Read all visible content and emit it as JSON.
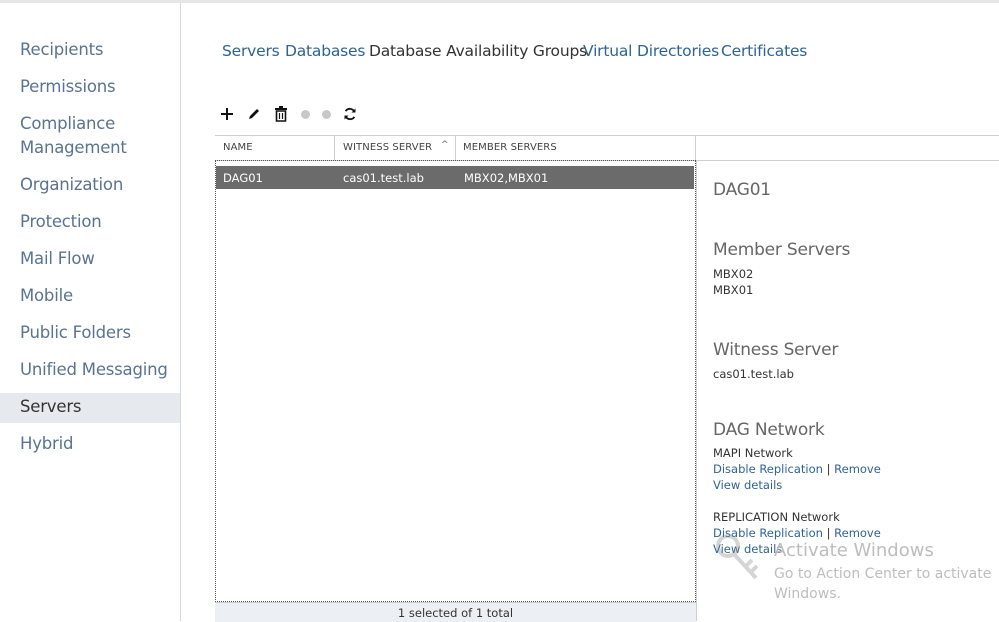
{
  "sidebar": {
    "items": [
      {
        "label": "Recipients"
      },
      {
        "label": "Permissions"
      },
      {
        "label_line1": "Compliance",
        "label_line2": "Management"
      },
      {
        "label": "Organization"
      },
      {
        "label": "Protection"
      },
      {
        "label": "Mail Flow"
      },
      {
        "label": "Mobile"
      },
      {
        "label": "Public Folders"
      },
      {
        "label": "Unified Messaging"
      },
      {
        "label": "Servers",
        "selected": true
      },
      {
        "label": "Hybrid"
      }
    ]
  },
  "tabs": [
    {
      "label": "Servers"
    },
    {
      "label": "Databases"
    },
    {
      "label": "Database Availability Groups",
      "active": true
    },
    {
      "label": "Virtual Directories"
    },
    {
      "label": "Certificates"
    }
  ],
  "toolbar": {
    "icons": [
      "add-icon",
      "edit-icon",
      "delete-icon",
      "disabled-action-icon",
      "disabled-action-icon",
      "refresh-icon"
    ]
  },
  "grid": {
    "columns": [
      "NAME",
      "WITNESS SERVER",
      "MEMBER SERVERS"
    ],
    "rows": [
      {
        "name": "DAG01",
        "witness": "cas01.test.lab",
        "members": "MBX02,MBX01",
        "selected": true
      }
    ],
    "status": "1 selected of 1 total"
  },
  "details": {
    "name": "DAG01",
    "member_servers_title": "Member Servers",
    "member_servers": [
      "MBX02",
      "MBX01"
    ],
    "witness_title": "Witness Server",
    "witness_value": "cas01.test.lab",
    "dag_network_title": "DAG Network",
    "networks": [
      {
        "name": "MAPI Network",
        "disable": "Disable Replication",
        "sep": "|",
        "remove": "Remove",
        "view": "View details"
      },
      {
        "name": "REPLICATION Network",
        "disable": "Disable Replication",
        "sep": "|",
        "remove": "Remove",
        "view": "View details"
      }
    ]
  },
  "watermark": {
    "title": "Activate Windows",
    "line1": "Go to Action Center to activate",
    "line2": "Windows."
  },
  "colors": {
    "link": "#2e6494",
    "selected_row": "#6b6b6b",
    "sidebar_selected": "#e6e9ee"
  }
}
